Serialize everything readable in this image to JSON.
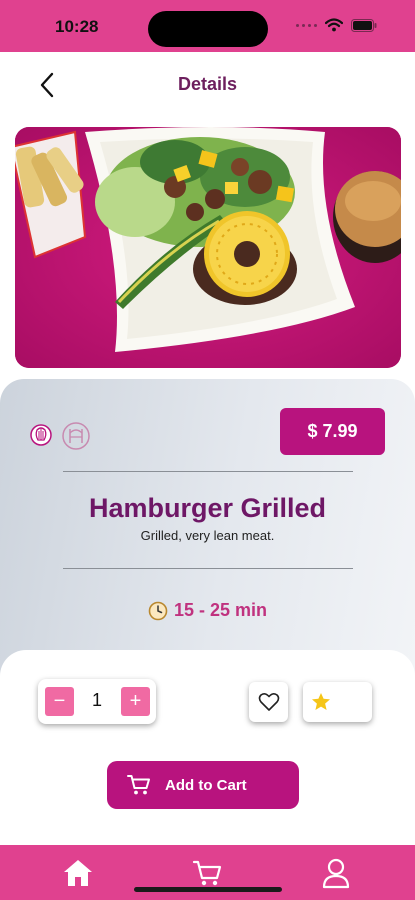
{
  "status_bar": {
    "time": "10:28"
  },
  "header": {
    "title": "Details"
  },
  "product": {
    "name": "Hamburger Grilled",
    "description": "Grilled, very lean meat.",
    "price": "$ 7.99",
    "prep_time": "15 - 25 min"
  },
  "quantity": {
    "value": "1",
    "minus": "−",
    "plus": "+"
  },
  "actions": {
    "add_to_cart": "Add to Cart"
  },
  "icons": {
    "back": "chevron-left-icon",
    "favorite": "heart-icon",
    "rating": "star-icon",
    "clock": "clock-icon",
    "cart": "cart-icon",
    "home": "home-icon",
    "profile": "user-icon"
  },
  "colors": {
    "brand_pink": "#e0418f",
    "accent_magenta": "#b8137e",
    "title_purple": "#6e1766",
    "stepper_pink": "#f06aa3",
    "star_yellow": "#f5c518"
  }
}
